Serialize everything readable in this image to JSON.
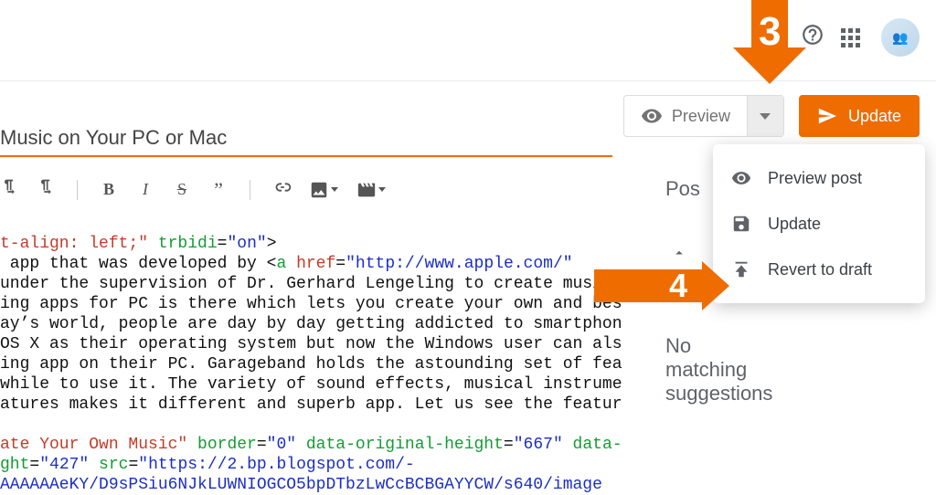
{
  "topbar": {
    "help_icon": "help-circle",
    "apps_icon": "apps-grid",
    "avatar_alt": "Account avatar"
  },
  "actions": {
    "preview_label": "Preview",
    "update_label": "Update"
  },
  "title": "Music on Your PC or Mac",
  "toolbar": {
    "ltr": "ltr-icon",
    "rtl": "rtl-icon",
    "bold": "B",
    "italic": "I",
    "strike": "S",
    "quote": "”",
    "link": "link-icon",
    "image": "image-icon",
    "video": "video-icon"
  },
  "editor": {
    "frag1_attr": "t-align: left;\"",
    "frag1_trbidi_label": " trbidi",
    "frag1_eq": "=",
    "frag1_trbidi_val": "\"on\"",
    "frag1_end": ">",
    "line2_pre": " app that was developed by ",
    "line2_open": "<",
    "line2_tag": "a ",
    "line2_attr": "href",
    "line2_href": "\"http://www.apple.com/\"",
    "line3": "under the supervision of Dr. Gerhard Lengeling to create music o",
    "line4": "ing apps for PC is there which lets you create your own and best",
    "line5": "ay’s world, people are day by day getting addicted to smartphones,",
    "line6": "OS X as their operating system but now the Windows user can also",
    "line7": "ing app on their PC. Garageband holds the astounding set of features",
    "line8": "while to use it. The variety of sound effects, musical instruments,",
    "line9": "atures makes it different and superb app. Let us see the features of",
    "img_alt_attr": "ate Your Own Music\"",
    "img_border_label": " border",
    "img_border_val": "\"0\"",
    "img_doh_label": " data-original-height",
    "img_doh_val": "\"667\"",
    "img_data_trail": " data-",
    "img_ht_label": "ght",
    "img_ht_val": "\"427\"",
    "img_src_label": " src",
    "img_src_val": "\"https://2.bp.blogspot.com/-",
    "img_blob": "AAAAAAeKY/D9sPSiu6NJkLUWNIOGCO5bpDTbzLwCcBCBGAYYCW/s640/image"
  },
  "dropdown": {
    "items": [
      {
        "icon": "eye-icon",
        "label": "Preview post"
      },
      {
        "icon": "save-icon",
        "label": "Update"
      },
      {
        "icon": "revert-icon",
        "label": "Revert to draft"
      }
    ]
  },
  "sidepanel": {
    "heading_fragment": "Pos",
    "no_match": "No matching suggestions"
  },
  "annotations": {
    "step3": "3",
    "step4": "4"
  }
}
